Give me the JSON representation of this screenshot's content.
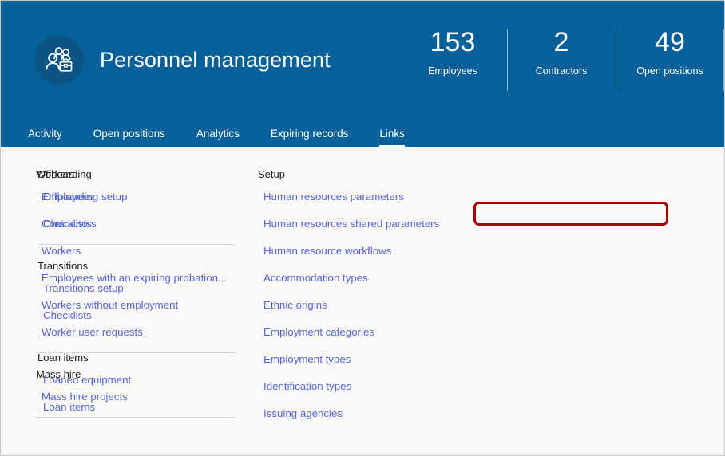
{
  "header": {
    "title": "Personnel management",
    "icon": "people-briefcase-icon",
    "background_color": "#06609a",
    "stats": [
      {
        "value": "153",
        "label": "Employees"
      },
      {
        "value": "2",
        "label": "Contractors"
      },
      {
        "value": "49",
        "label": "Open positions"
      }
    ],
    "tabs": [
      {
        "label": "Activity",
        "active": false
      },
      {
        "label": "Open positions",
        "active": false
      },
      {
        "label": "Analytics",
        "active": false
      },
      {
        "label": "Expiring records",
        "active": false
      },
      {
        "label": "Links",
        "active": true
      }
    ]
  },
  "links_panel": {
    "background_color": "#faf9f8",
    "link_color": "#5466d6",
    "heading_color": "#201f1e",
    "columns": [
      {
        "groups": [
          {
            "title": "Workers",
            "links": [
              "Employees",
              "Contractors",
              "Workers",
              "Employees with an expiring probation...",
              "Workers without employment",
              "Worker user requests"
            ]
          },
          {
            "title": "Mass hire",
            "links": [
              "Mass hire projects"
            ]
          }
        ]
      },
      {
        "groups": [
          {
            "title": "Offboarding",
            "links": [
              "Offboarding setup",
              "Checklists"
            ]
          },
          {
            "title": "Transitions",
            "links": [
              "Transitions setup",
              "Checklists"
            ]
          },
          {
            "title": "Loan items",
            "links": [
              "Loaned equipment",
              "Loan items"
            ]
          }
        ]
      },
      {
        "groups": [
          {
            "title": "Setup",
            "links": [
              "Human resources parameters",
              "Human resources shared parameters",
              "Human resource workflows",
              "Accommodation types",
              "Ethnic origins",
              "Employment categories",
              "Employment types",
              "Identification types",
              "Issuing agencies"
            ]
          }
        ]
      }
    ]
  },
  "annotation": {
    "target_label": "Human resources parameters",
    "color": "#a80000"
  }
}
